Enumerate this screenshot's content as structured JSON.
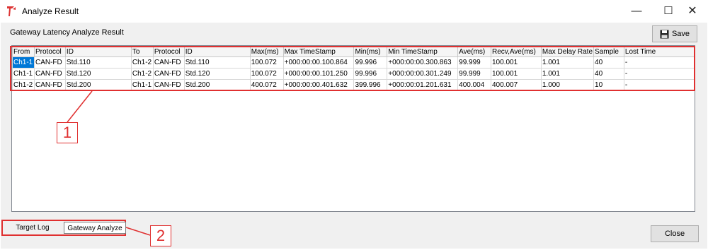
{
  "window": {
    "title": "Analyze Result",
    "icon": "app-logo-icon",
    "controls": [
      "minimize-icon",
      "maximize-icon",
      "close-icon"
    ]
  },
  "group": {
    "label": "Gateway Latency Analyze Result"
  },
  "toolbar": {
    "save_label": "Save",
    "save_icon": "floppy-disk-icon"
  },
  "table": {
    "headers": [
      "From",
      "Protocol",
      "ID",
      "To",
      "Protocol",
      "ID",
      "Max(ms)",
      "Max TimeStamp",
      "Min(ms)",
      "Min TimeStamp",
      "Ave(ms)",
      "Recv,Ave(ms)",
      "Max Delay Rate",
      "Sample",
      "Lost Time"
    ],
    "rows": [
      [
        "Ch1-1",
        "CAN-FD",
        "Std.110",
        "Ch1-2",
        "CAN-FD",
        "Std.110",
        "100.072",
        "+000:00:00.100.864",
        "99.996",
        "+000:00:00.300.863",
        "99.999",
        "100.001",
        "1.001",
        "40",
        "-"
      ],
      [
        "Ch1-1",
        "CAN-FD",
        "Std.120",
        "Ch1-2",
        "CAN-FD",
        "Std.120",
        "100.072",
        "+000:00:00.101.250",
        "99.996",
        "+000:00:00.301.249",
        "99.999",
        "100.001",
        "1.001",
        "40",
        "-"
      ],
      [
        "Ch1-2",
        "CAN-FD",
        "Std.200",
        "Ch1-1",
        "CAN-FD",
        "Std.200",
        "400.072",
        "+000:00:00.401.632",
        "399.996",
        "+000:00:01.201.631",
        "400.004",
        "400.007",
        "1.000",
        "10",
        "-"
      ]
    ],
    "selected_cell": "Ch1-1"
  },
  "annotations": {
    "label_1": "1",
    "label_2": "2",
    "color": "#e03030"
  },
  "tabs": [
    {
      "label": "Target Log",
      "active": false
    },
    {
      "label": "Gateway Analyze",
      "active": true
    }
  ],
  "footer": {
    "close_label": "Close"
  },
  "colors": {
    "selection": "#0078d7",
    "annotation": "#e03030",
    "client_bg": "#f0f0f0"
  }
}
